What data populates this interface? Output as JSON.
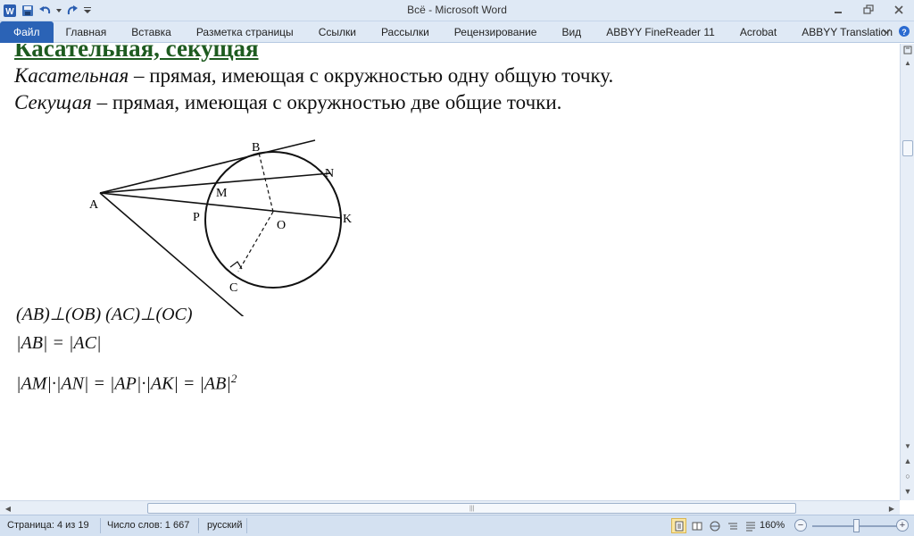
{
  "window": {
    "title": "Всё  -  Microsoft Word"
  },
  "ribbon": {
    "tabs": [
      {
        "label": "Файл"
      },
      {
        "label": "Главная"
      },
      {
        "label": "Вставка"
      },
      {
        "label": "Разметка страницы"
      },
      {
        "label": "Ссылки"
      },
      {
        "label": "Рассылки"
      },
      {
        "label": "Рецензирование"
      },
      {
        "label": "Вид"
      },
      {
        "label": "ABBYY FineReader 11"
      },
      {
        "label": "Acrobat"
      },
      {
        "label": "ABBYY Translation"
      }
    ]
  },
  "document": {
    "heading": "Касательная, секущая",
    "line1_term": "Касательная",
    "line1_rest": " – прямая, имеющая с окружностью одну общую точку.",
    "line2_term": "Секущая",
    "line2_rest": " – прямая, имеющая с окружностью две общие точки.",
    "figure_points": {
      "A": "A",
      "B": "B",
      "N": "N",
      "M": "M",
      "P": "P",
      "O": "O",
      "K": "K",
      "C": "C"
    },
    "formula1": "(AB)⊥(OB)   (AC)⊥(OC)",
    "formula2": "|AB| = |AC|",
    "formula3": "|AM|·|AN| = |AP|·|AK| = |AB|",
    "formula3_exp": "2"
  },
  "statusbar": {
    "page": "Страница: 4 из 19",
    "words": "Число слов: 1 667",
    "language": "русский",
    "zoom": "160%"
  },
  "colors": {
    "heading": "#1e5b20",
    "file_tab": "#2b63b6",
    "chrome": "#dfe9f5"
  }
}
